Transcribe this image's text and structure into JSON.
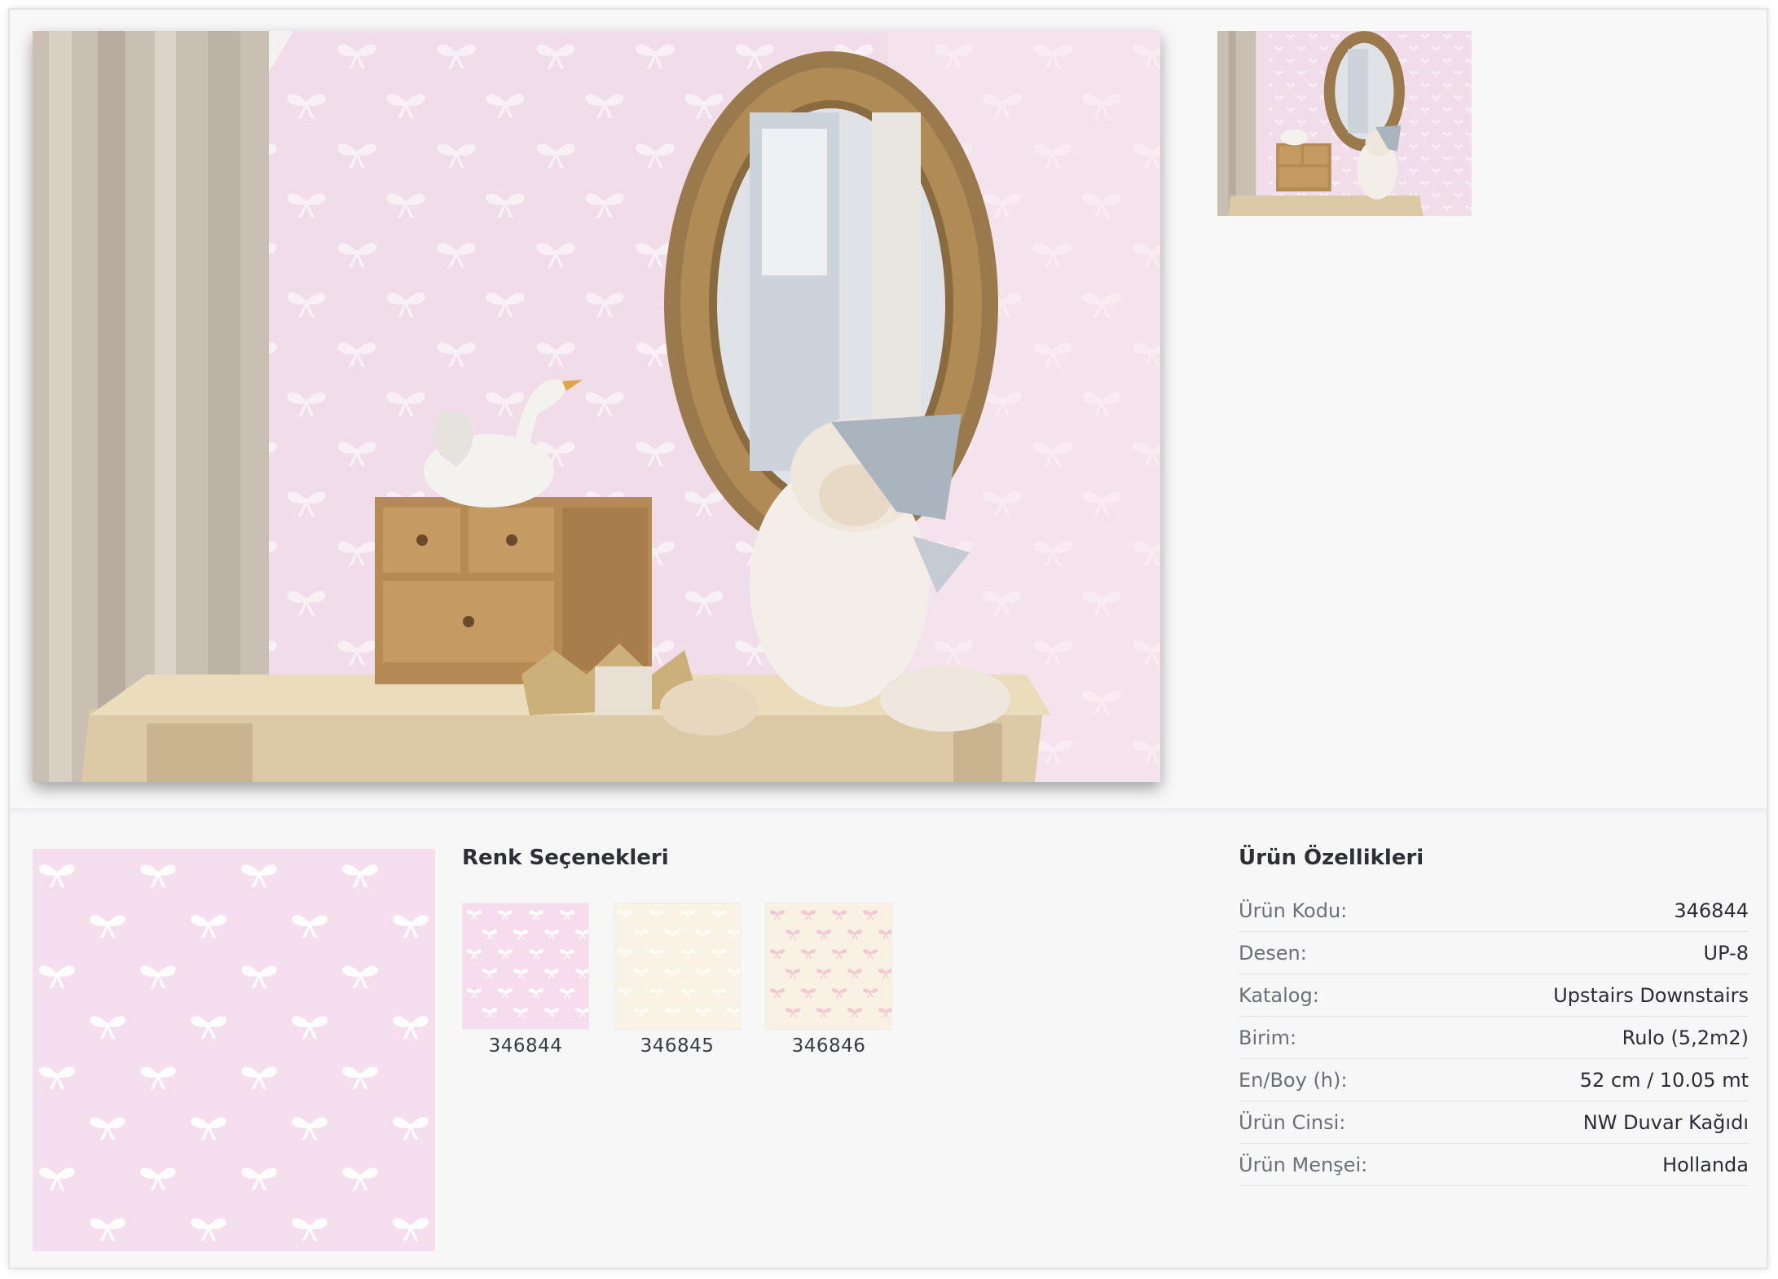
{
  "gallery": {
    "main_image_icon": "room-photo",
    "thumbnail_icon": "room-photo"
  },
  "pattern": {
    "background": "#f5dfee",
    "bow_color": "#ffffff"
  },
  "color_options": {
    "title": "Renk Seçenekleri",
    "items": [
      {
        "code": "346844",
        "bg": "#f6dcec",
        "bow": "#ffffff"
      },
      {
        "code": "346845",
        "bg": "#f8f3e4",
        "bow": "#fbf9f1"
      },
      {
        "code": "346846",
        "bg": "#f8f1e4",
        "bow": "#f3cfd7"
      }
    ]
  },
  "features": {
    "title": "Ürün Özellikleri",
    "rows": [
      {
        "label": "Ürün Kodu:",
        "value": "346844"
      },
      {
        "label": "Desen:",
        "value": "UP-8"
      },
      {
        "label": "Katalog:",
        "value": "Upstairs Downstairs"
      },
      {
        "label": "Birim:",
        "value": "Rulo (5,2m2)"
      },
      {
        "label": "En/Boy (h):",
        "value": "52 cm / 10.05 mt"
      },
      {
        "label": "Ürün Cinsi:",
        "value": "NW Duvar Kağıdı"
      },
      {
        "label": "Ürün Menşei:",
        "value": "Hollanda"
      }
    ]
  }
}
